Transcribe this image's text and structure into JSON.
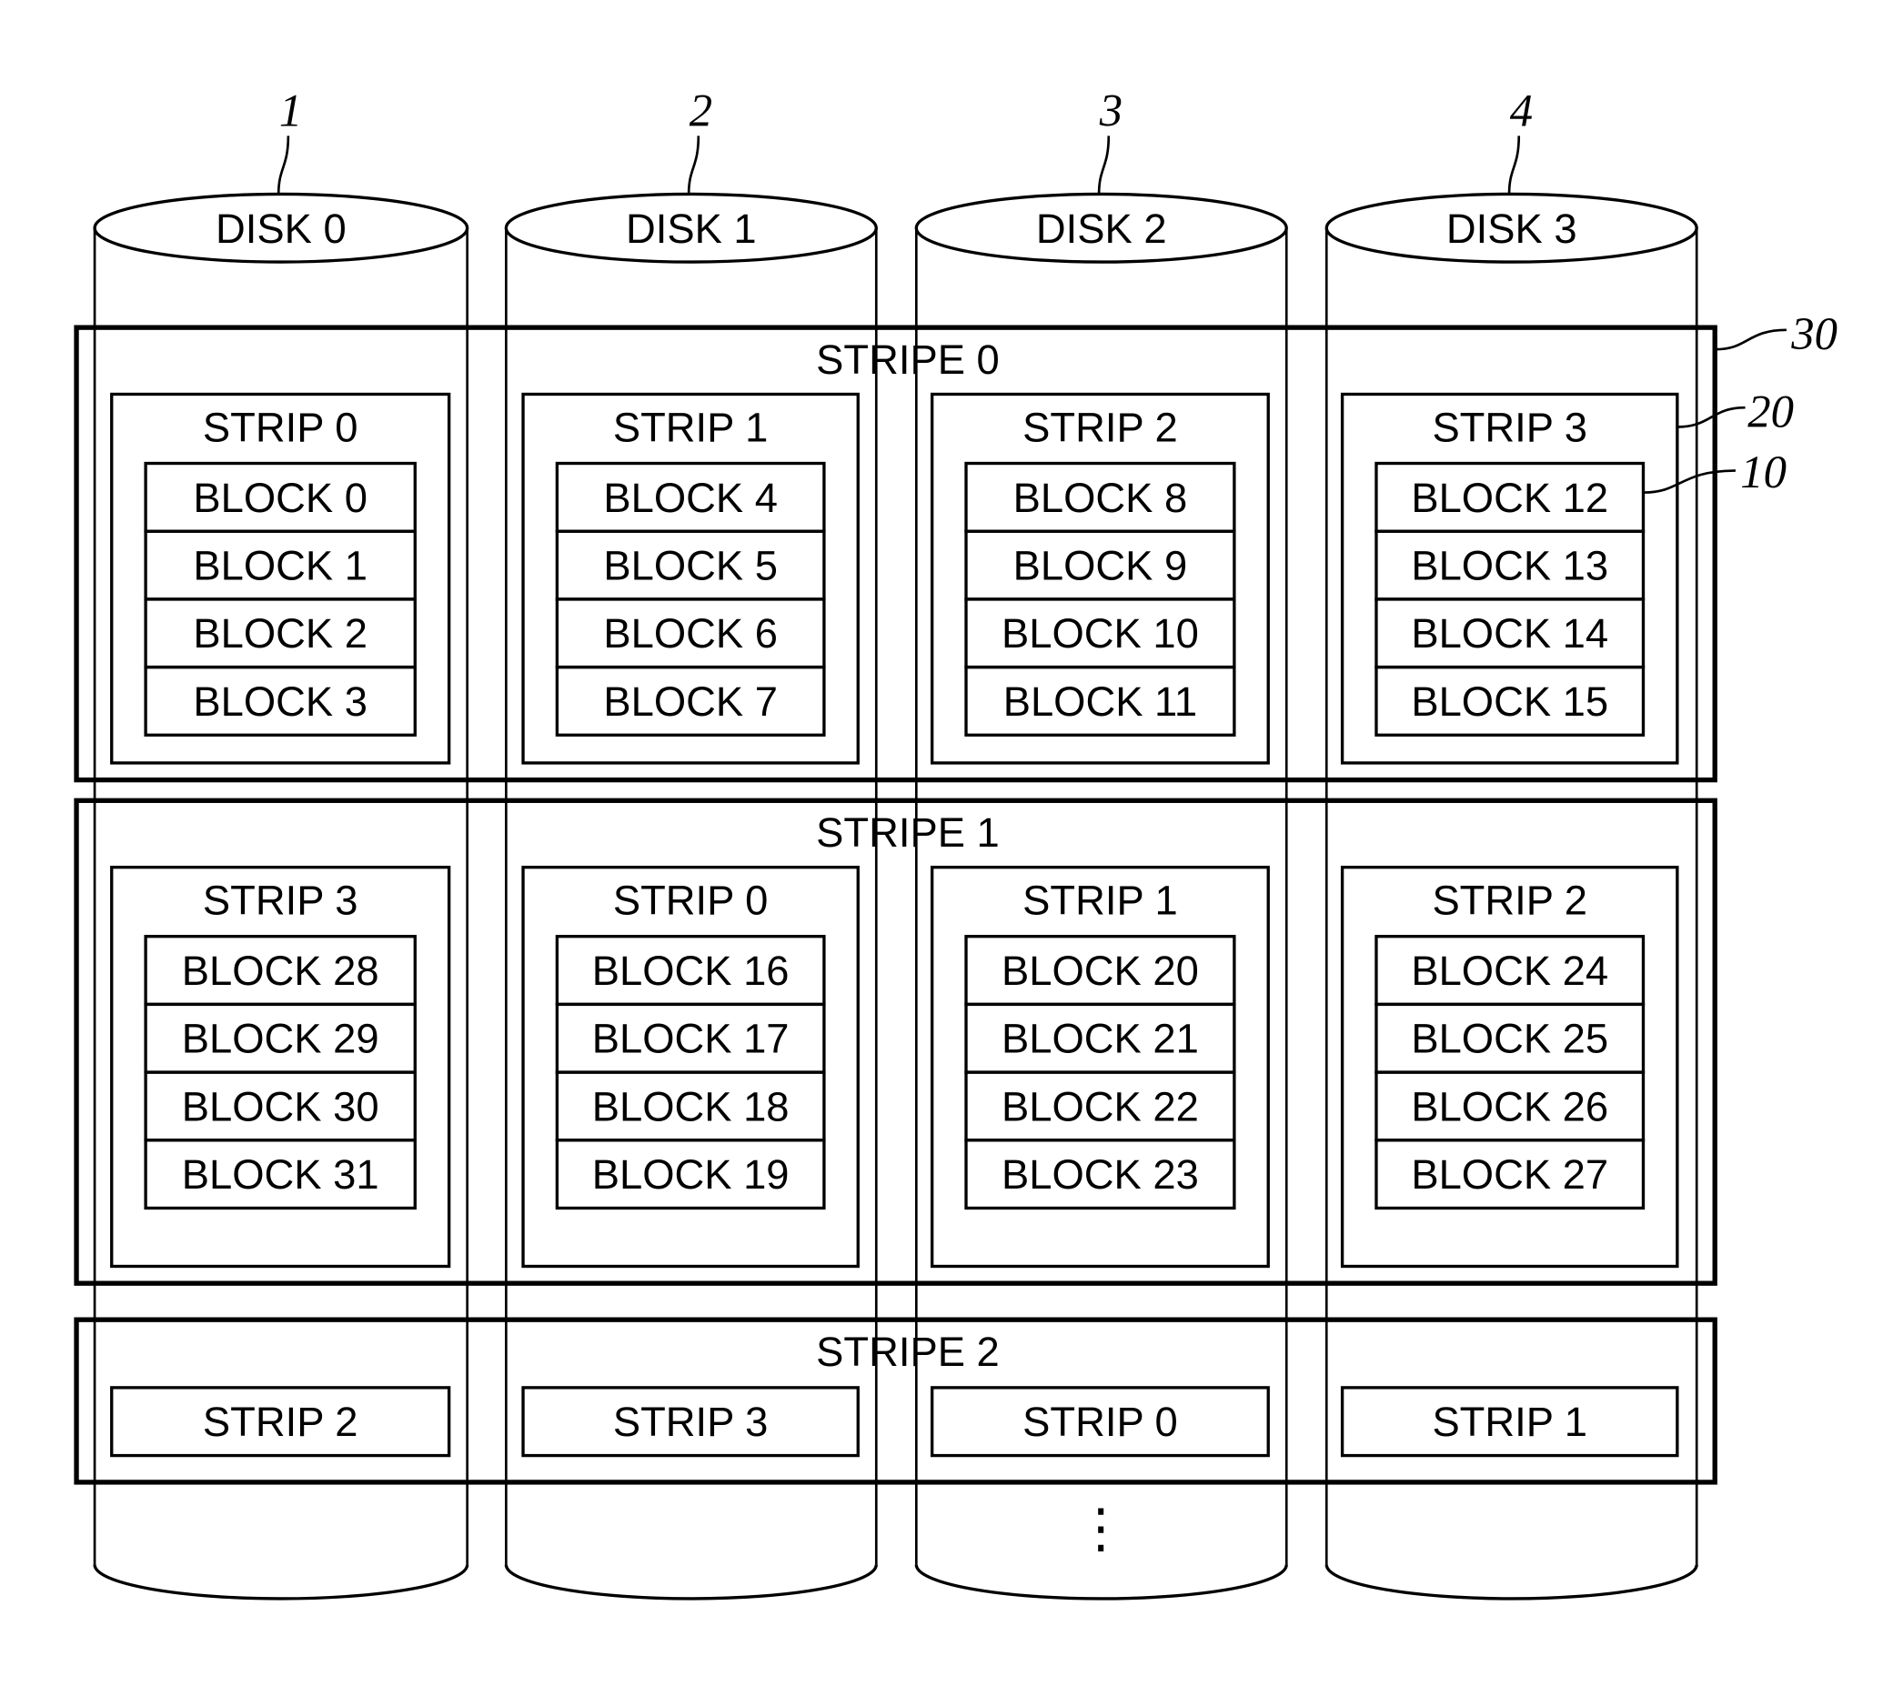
{
  "disks": [
    {
      "label": "DISK 0",
      "ref": "1"
    },
    {
      "label": "DISK 1",
      "ref": "2"
    },
    {
      "label": "DISK 2",
      "ref": "3"
    },
    {
      "label": "DISK 3",
      "ref": "4"
    }
  ],
  "stripes": [
    {
      "label": "STRIPE 0",
      "strips": [
        {
          "label": "STRIP 0",
          "blocks": [
            "BLOCK 0",
            "BLOCK 1",
            "BLOCK 2",
            "BLOCK 3"
          ]
        },
        {
          "label": "STRIP 1",
          "blocks": [
            "BLOCK 4",
            "BLOCK 5",
            "BLOCK 6",
            "BLOCK 7"
          ]
        },
        {
          "label": "STRIP 2",
          "blocks": [
            "BLOCK 8",
            "BLOCK 9",
            "BLOCK 10",
            "BLOCK 11"
          ]
        },
        {
          "label": "STRIP 3",
          "blocks": [
            "BLOCK 12",
            "BLOCK 13",
            "BLOCK 14",
            "BLOCK 15"
          ]
        }
      ]
    },
    {
      "label": "STRIPE 1",
      "strips": [
        {
          "label": "STRIP 3",
          "blocks": [
            "BLOCK 28",
            "BLOCK 29",
            "BLOCK 30",
            "BLOCK 31"
          ]
        },
        {
          "label": "STRIP 0",
          "blocks": [
            "BLOCK 16",
            "BLOCK 17",
            "BLOCK 18",
            "BLOCK 19"
          ]
        },
        {
          "label": "STRIP 1",
          "blocks": [
            "BLOCK 20",
            "BLOCK 21",
            "BLOCK 22",
            "BLOCK 23"
          ]
        },
        {
          "label": "STRIP 2",
          "blocks": [
            "BLOCK 24",
            "BLOCK 25",
            "BLOCK 26",
            "BLOCK 27"
          ]
        }
      ]
    },
    {
      "label": "STRIPE 2",
      "strips": [
        {
          "label": "STRIP 2",
          "blocks": []
        },
        {
          "label": "STRIP 3",
          "blocks": []
        },
        {
          "label": "STRIP 0",
          "blocks": []
        },
        {
          "label": "STRIP 1",
          "blocks": []
        }
      ]
    }
  ],
  "reference_labels": {
    "stripe": "30",
    "strip": "20",
    "block": "10"
  },
  "continuation": "⋮"
}
